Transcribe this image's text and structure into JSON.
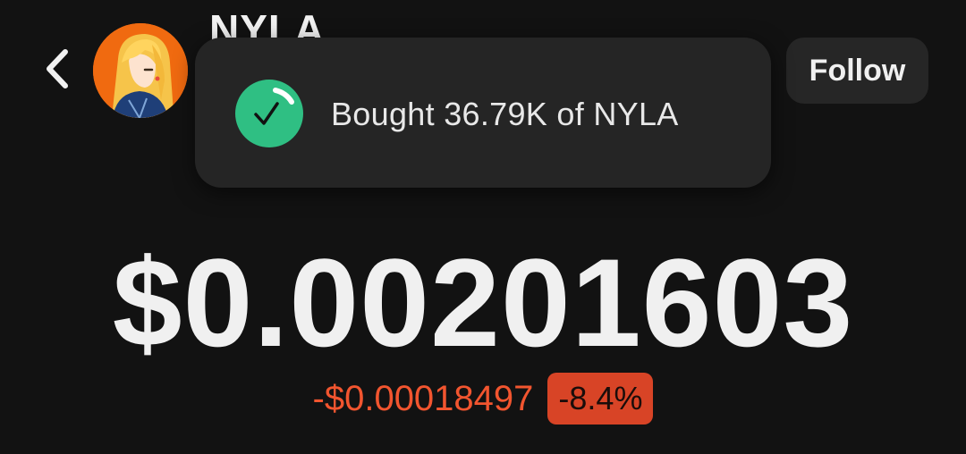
{
  "header": {
    "back_icon": "chevron-left-icon",
    "token_name": "NYLA",
    "follow_label": "Follow"
  },
  "toast": {
    "icon": "check-circle-icon",
    "message": "Bought 36.79K of NYLA",
    "icon_color": "#2fbf83"
  },
  "price": {
    "value": "$0.00201603",
    "change_abs": "-$0.00018497",
    "change_pct": "-8.4%",
    "negative_color": "#f2552f"
  }
}
